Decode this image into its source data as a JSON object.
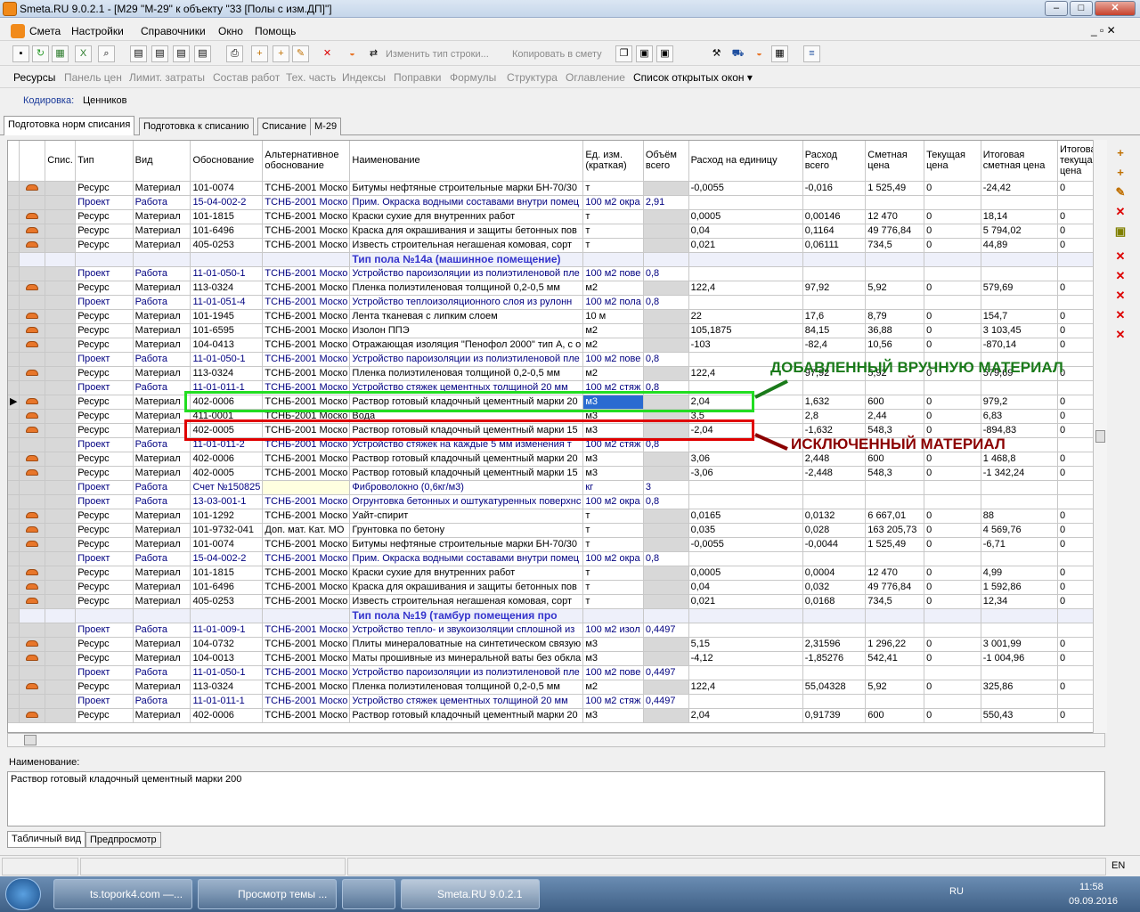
{
  "window": {
    "title": "Smeta.RU  9.0.2.1  - [M29 \"M-29\" к объекту \"33 [Полы с изм.ДП]\"]",
    "min": "–",
    "max": "□",
    "close": "✕"
  },
  "menu": [
    "Смета",
    "Настройки",
    "Справочники",
    "Окно",
    "Помощь"
  ],
  "toolbar1": {
    "change_row": "Изменить тип строки...",
    "copy_to": "Копировать в смету"
  },
  "toolbar2": [
    "Ресурсы",
    "Панель цен",
    "Лимит. затраты",
    "Состав работ",
    "Тех. часть",
    "Индексы",
    "Поправки",
    "Формулы",
    "Структура",
    "Оглавление",
    "Список открытых окон ▾"
  ],
  "coding": {
    "label": "Кодировка:",
    "value": "Ценников"
  },
  "tabs": [
    "Подготовка норм списания",
    "Подготовка к списанию",
    "Списание",
    "М-29"
  ],
  "columns": [
    "",
    "",
    "Спис.",
    "Тип",
    "Вид",
    "Обоснование",
    "Альтернативное обоснование",
    "Наименование",
    "Ед. изм. (краткая)",
    "Объём всего",
    "Расход на единицу",
    "Расход всего",
    "Сметная цена",
    "Текущая цена",
    "Итоговая сметная цена",
    "Итоговая текущая цена"
  ],
  "rows": [
    {
      "k": "r",
      "t": "Ресурс",
      "v": "Материал",
      "o": "101-0074",
      "a": "ТСНБ-2001 Моско",
      "n": "Битумы нефтяные строительные марки БН-70/30",
      "u": "т",
      "vol": "",
      "re": "-0,0055",
      "rt": "-0,016",
      "sp": "1 525,49",
      "cp": "0",
      "is": "-24,42",
      "it": "0"
    },
    {
      "k": "p",
      "t": "Проект",
      "v": "Работа",
      "o": "15-04-002-2",
      "a": "ТСНБ-2001 Моско",
      "n": "Прим. Окраска водными составами внутри помец",
      "u": "100 м2 окра",
      "vol": "2,91",
      "re": "",
      "rt": "",
      "sp": "",
      "cp": "",
      "is": "",
      "it": ""
    },
    {
      "k": "r",
      "t": "Ресурс",
      "v": "Материал",
      "o": "101-1815",
      "a": "ТСНБ-2001 Моско",
      "n": "Краски сухие для внутренних работ",
      "u": "т",
      "vol": "",
      "re": "0,0005",
      "rt": "0,00146",
      "sp": "12 470",
      "cp": "0",
      "is": "18,14",
      "it": "0"
    },
    {
      "k": "r",
      "t": "Ресурс",
      "v": "Материал",
      "o": "101-6496",
      "a": "ТСНБ-2001 Моско",
      "n": "Краска для окрашивания и защиты бетонных пов",
      "u": "т",
      "vol": "",
      "re": "0,04",
      "rt": "0,1164",
      "sp": "49 776,84",
      "cp": "0",
      "is": "5 794,02",
      "it": "0"
    },
    {
      "k": "r",
      "t": "Ресурс",
      "v": "Материал",
      "o": "405-0253",
      "a": "ТСНБ-2001 Моско",
      "n": "Известь строительная негашеная комовая, сорт",
      "u": "т",
      "vol": "",
      "re": "0,021",
      "rt": "0,06111",
      "sp": "734,5",
      "cp": "0",
      "is": "44,89",
      "it": "0"
    },
    {
      "k": "h",
      "n": "Тип пола №14а (машинное помещение)"
    },
    {
      "k": "p",
      "t": "Проект",
      "v": "Работа",
      "o": "11-01-050-1",
      "a": "ТСНБ-2001 Моско",
      "n": "Устройство пароизоляции из полиэтиленовой пле",
      "u": "100 м2 пове",
      "vol": "0,8",
      "re": "",
      "rt": "",
      "sp": "",
      "cp": "",
      "is": "",
      "it": ""
    },
    {
      "k": "r",
      "t": "Ресурс",
      "v": "Материал",
      "o": "113-0324",
      "a": "ТСНБ-2001 Моско",
      "n": "Пленка полиэтиленовая толщиной 0,2-0,5 мм",
      "u": "м2",
      "vol": "",
      "re": "122,4",
      "rt": "97,92",
      "sp": "5,92",
      "cp": "0",
      "is": "579,69",
      "it": "0"
    },
    {
      "k": "p",
      "t": "Проект",
      "v": "Работа",
      "o": "11-01-051-4",
      "a": "ТСНБ-2001 Моско",
      "n": "Устройство теплоизоляционного слоя из рулонн",
      "u": "100 м2 пола",
      "vol": "0,8",
      "re": "",
      "rt": "",
      "sp": "",
      "cp": "",
      "is": "",
      "it": ""
    },
    {
      "k": "r",
      "t": "Ресурс",
      "v": "Материал",
      "o": "101-1945",
      "a": "ТСНБ-2001 Моско",
      "n": "Лента тканевая с липким слоем",
      "u": "10 м",
      "vol": "",
      "re": "22",
      "rt": "17,6",
      "sp": "8,79",
      "cp": "0",
      "is": "154,7",
      "it": "0"
    },
    {
      "k": "r",
      "t": "Ресурс",
      "v": "Материал",
      "o": "101-6595",
      "a": "ТСНБ-2001 Моско",
      "n": "Изолон ППЭ",
      "u": "м2",
      "vol": "",
      "re": "105,1875",
      "rt": "84,15",
      "sp": "36,88",
      "cp": "0",
      "is": "3 103,45",
      "it": "0"
    },
    {
      "k": "r",
      "t": "Ресурс",
      "v": "Материал",
      "o": "104-0413",
      "a": "ТСНБ-2001 Моско",
      "n": "Отражающая изоляция \"Пенофол 2000\" тип А, с о",
      "u": "м2",
      "vol": "",
      "re": "-103",
      "rt": "-82,4",
      "sp": "10,56",
      "cp": "0",
      "is": "-870,14",
      "it": "0"
    },
    {
      "k": "p",
      "t": "Проект",
      "v": "Работа",
      "o": "11-01-050-1",
      "a": "ТСНБ-2001 Моско",
      "n": "Устройство пароизоляции из полиэтиленовой пле",
      "u": "100 м2 пове",
      "vol": "0,8",
      "re": "",
      "rt": "",
      "sp": "",
      "cp": "",
      "is": "",
      "it": ""
    },
    {
      "k": "r",
      "t": "Ресурс",
      "v": "Материал",
      "o": "113-0324",
      "a": "ТСНБ-2001 Моско",
      "n": "Пленка полиэтиленовая толщиной 0,2-0,5 мм",
      "u": "м2",
      "vol": "",
      "re": "122,4",
      "rt": "97,92",
      "sp": "5,92",
      "cp": "0",
      "is": "579,69",
      "it": "0"
    },
    {
      "k": "p",
      "t": "Проект",
      "v": "Работа",
      "o": "11-01-011-1",
      "a": "ТСНБ-2001 Моско",
      "n": "Устройство стяжек цементных толщиной 20 мм",
      "u": "100 м2 стяж",
      "vol": "0,8",
      "re": "",
      "rt": "",
      "sp": "",
      "cp": "",
      "is": "",
      "it": ""
    },
    {
      "k": "r",
      "sel": true,
      "t": "Ресурс",
      "v": "Материал",
      "o": "402-0006",
      "a": "ТСНБ-2001 Моско",
      "n": "Раствор готовый кладочный цементный марки 20",
      "u": "м3",
      "vol": "",
      "re": "2,04",
      "rt": "1,632",
      "sp": "600",
      "cp": "0",
      "is": "979,2",
      "it": "0"
    },
    {
      "k": "r",
      "t": "Ресурс",
      "v": "Материал",
      "o": "411-0001",
      "a": "ТСНБ-2001 Моско",
      "n": "Вода",
      "u": "м3",
      "vol": "",
      "re": "3,5",
      "rt": "2,8",
      "sp": "2,44",
      "cp": "0",
      "is": "6,83",
      "it": "0"
    },
    {
      "k": "r",
      "t": "Ресурс",
      "v": "Материал",
      "o": "402-0005",
      "a": "ТСНБ-2001 Моско",
      "n": "Раствор готовый кладочный цементный марки 15",
      "u": "м3",
      "vol": "",
      "re": "-2,04",
      "rt": "-1,632",
      "sp": "548,3",
      "cp": "0",
      "is": "-894,83",
      "it": "0"
    },
    {
      "k": "p",
      "t": "Проект",
      "v": "Работа",
      "o": "11-01-011-2",
      "a": "ТСНБ-2001 Моско",
      "n": "Устройство стяжек на каждые 5 мм изменения т",
      "u": "100 м2 стяж",
      "vol": "0,8",
      "re": "",
      "rt": "",
      "sp": "",
      "cp": "",
      "is": "",
      "it": ""
    },
    {
      "k": "r",
      "t": "Ресурс",
      "v": "Материал",
      "o": "402-0006",
      "a": "ТСНБ-2001 Моско",
      "n": "Раствор готовый кладочный цементный марки 20",
      "u": "м3",
      "vol": "",
      "re": "3,06",
      "rt": "2,448",
      "sp": "600",
      "cp": "0",
      "is": "1 468,8",
      "it": "0"
    },
    {
      "k": "r",
      "t": "Ресурс",
      "v": "Материал",
      "o": "402-0005",
      "a": "ТСНБ-2001 Моско",
      "n": "Раствор готовый кладочный цементный марки 15",
      "u": "м3",
      "vol": "",
      "re": "-3,06",
      "rt": "-2,448",
      "sp": "548,3",
      "cp": "0",
      "is": "-1 342,24",
      "it": "0"
    },
    {
      "k": "p",
      "t": "Проект",
      "v": "Работа",
      "o": "Счет №150825",
      "a": "",
      "n": "Фиброволокно (0,6кг/м3)",
      "u": "кг",
      "vol": "3",
      "re": "",
      "rt": "",
      "sp": "",
      "cp": "",
      "is": "",
      "it": ""
    },
    {
      "k": "p",
      "t": "Проект",
      "v": "Работа",
      "o": "13-03-001-1",
      "a": "ТСНБ-2001 Моско",
      "n": "Огрунтовка бетонных и оштукатуренных поверхнс",
      "u": "100 м2 окра",
      "vol": "0,8",
      "re": "",
      "rt": "",
      "sp": "",
      "cp": "",
      "is": "",
      "it": ""
    },
    {
      "k": "r",
      "t": "Ресурс",
      "v": "Материал",
      "o": "101-1292",
      "a": "ТСНБ-2001 Моско",
      "n": "Уайт-спирит",
      "u": "т",
      "vol": "",
      "re": "0,0165",
      "rt": "0,0132",
      "sp": "6 667,01",
      "cp": "0",
      "is": "88",
      "it": "0"
    },
    {
      "k": "r",
      "t": "Ресурс",
      "v": "Материал",
      "o": "101-9732-041",
      "a": "Доп. мат. Кат. МО",
      "n": "Грунтовка по бетону",
      "u": "т",
      "vol": "",
      "re": "0,035",
      "rt": "0,028",
      "sp": "163 205,73",
      "cp": "0",
      "is": "4 569,76",
      "it": "0"
    },
    {
      "k": "r",
      "t": "Ресурс",
      "v": "Материал",
      "o": "101-0074",
      "a": "ТСНБ-2001 Моско",
      "n": "Битумы нефтяные строительные марки БН-70/30",
      "u": "т",
      "vol": "",
      "re": "-0,0055",
      "rt": "-0,0044",
      "sp": "1 525,49",
      "cp": "0",
      "is": "-6,71",
      "it": "0"
    },
    {
      "k": "p",
      "t": "Проект",
      "v": "Работа",
      "o": "15-04-002-2",
      "a": "ТСНБ-2001 Моско",
      "n": "Прим. Окраска водными составами внутри помец",
      "u": "100 м2 окра",
      "vol": "0,8",
      "re": "",
      "rt": "",
      "sp": "",
      "cp": "",
      "is": "",
      "it": ""
    },
    {
      "k": "r",
      "t": "Ресурс",
      "v": "Материал",
      "o": "101-1815",
      "a": "ТСНБ-2001 Моско",
      "n": "Краски сухие для внутренних работ",
      "u": "т",
      "vol": "",
      "re": "0,0005",
      "rt": "0,0004",
      "sp": "12 470",
      "cp": "0",
      "is": "4,99",
      "it": "0"
    },
    {
      "k": "r",
      "t": "Ресурс",
      "v": "Материал",
      "o": "101-6496",
      "a": "ТСНБ-2001 Моско",
      "n": "Краска для окрашивания и защиты бетонных пов",
      "u": "т",
      "vol": "",
      "re": "0,04",
      "rt": "0,032",
      "sp": "49 776,84",
      "cp": "0",
      "is": "1 592,86",
      "it": "0"
    },
    {
      "k": "r",
      "t": "Ресурс",
      "v": "Материал",
      "o": "405-0253",
      "a": "ТСНБ-2001 Моско",
      "n": "Известь строительная негашеная комовая, сорт",
      "u": "т",
      "vol": "",
      "re": "0,021",
      "rt": "0,0168",
      "sp": "734,5",
      "cp": "0",
      "is": "12,34",
      "it": "0"
    },
    {
      "k": "h",
      "n": "Тип пола №19 (тамбур помещения про"
    },
    {
      "k": "p",
      "t": "Проект",
      "v": "Работа",
      "o": "11-01-009-1",
      "a": "ТСНБ-2001 Моско",
      "n": "Устройство тепло- и звукоизоляции сплошной из",
      "u": "100 м2 изол",
      "vol": "0,4497",
      "re": "",
      "rt": "",
      "sp": "",
      "cp": "",
      "is": "",
      "it": ""
    },
    {
      "k": "r",
      "t": "Ресурс",
      "v": "Материал",
      "o": "104-0732",
      "a": "ТСНБ-2001 Моско",
      "n": "Плиты минераловатные на синтетическом связую",
      "u": "м3",
      "vol": "",
      "re": "5,15",
      "rt": "2,31596",
      "sp": "1 296,22",
      "cp": "0",
      "is": "3 001,99",
      "it": "0"
    },
    {
      "k": "r",
      "t": "Ресурс",
      "v": "Материал",
      "o": "104-0013",
      "a": "ТСНБ-2001 Моско",
      "n": "Маты прошивные из минеральной ваты без обкла",
      "u": "м3",
      "vol": "",
      "re": "-4,12",
      "rt": "-1,85276",
      "sp": "542,41",
      "cp": "0",
      "is": "-1 004,96",
      "it": "0"
    },
    {
      "k": "p",
      "t": "Проект",
      "v": "Работа",
      "o": "11-01-050-1",
      "a": "ТСНБ-2001 Моско",
      "n": "Устройство пароизоляции из полиэтиленовой пле",
      "u": "100 м2 пове",
      "vol": "0,4497",
      "re": "",
      "rt": "",
      "sp": "",
      "cp": "",
      "is": "",
      "it": ""
    },
    {
      "k": "r",
      "t": "Ресурс",
      "v": "Материал",
      "o": "113-0324",
      "a": "ТСНБ-2001 Моско",
      "n": "Пленка полиэтиленовая толщиной 0,2-0,5 мм",
      "u": "м2",
      "vol": "",
      "re": "122,4",
      "rt": "55,04328",
      "sp": "5,92",
      "cp": "0",
      "is": "325,86",
      "it": "0"
    },
    {
      "k": "p",
      "t": "Проект",
      "v": "Работа",
      "o": "11-01-011-1",
      "a": "ТСНБ-2001 Моско",
      "n": "Устройство стяжек цементных толщиной 20 мм",
      "u": "100 м2 стяж",
      "vol": "0,4497",
      "re": "",
      "rt": "",
      "sp": "",
      "cp": "",
      "is": "",
      "it": ""
    },
    {
      "k": "r",
      "t": "Ресурс",
      "v": "Материал",
      "o": "402-0006",
      "a": "ТСНБ-2001 Моско",
      "n": "Раствор готовый кладочный цементный марки 20",
      "u": "м3",
      "vol": "",
      "re": "2,04",
      "rt": "0,91739",
      "sp": "600",
      "cp": "0",
      "is": "550,43",
      "it": "0"
    }
  ],
  "name_panel": {
    "label": "Наименование:",
    "value": "Раствор готовый кладочный цементный марки 200"
  },
  "bottom_tabs": [
    "Табличный вид",
    "Предпросмотр"
  ],
  "status": {
    "lang": "EN"
  },
  "annotations": {
    "added": "ДОБАВЛЕННЫЙ ВРУЧНУЮ МАТЕРИАЛ",
    "excluded": "ИСКЛЮЧЕННЫЙ МАТЕРИАЛ",
    "added_color": "#1a7a1a",
    "excluded_color": "#8b0000"
  },
  "taskbar": {
    "items": [
      "ts.topork4.com —...",
      "Просмотр темы ...",
      "",
      "Smeta.RU  9.0.2.1"
    ],
    "lang": "RU",
    "time": "11:58",
    "date": "09.09.2016"
  }
}
